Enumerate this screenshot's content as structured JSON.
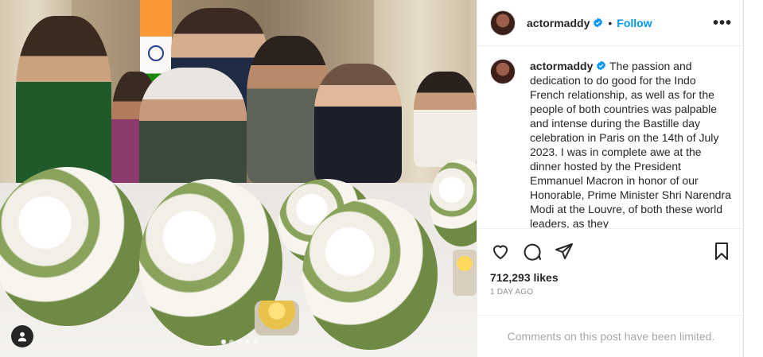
{
  "post": {
    "username": "actormaddy",
    "verified_badge": "verified-icon",
    "separator": "•",
    "follow_label": "Follow",
    "more_label": "•••",
    "caption": "The passion and dedication to do good for the Indo French relationship, as well as for the people of both countries was palpable and intense during the Bastille day celebration in Paris on the 14th of July 2023. I was in complete awe at the dinner hosted by the President Emmanuel Macron in honor of our Honorable, Prime Minister Shri Narendra Modi at the Louvre, of both these world leaders, as they",
    "likes": "712,293 likes",
    "time_ago": "1 DAY AGO",
    "comments_notice": "Comments on this post have been limited."
  },
  "media": {
    "carousel_total": 5,
    "carousel_active": 0,
    "tag_icon": "user-tag-icon"
  },
  "actions": {
    "like_icon": "heart-icon",
    "comment_icon": "comment-icon",
    "share_icon": "share-icon",
    "save_icon": "bookmark-icon"
  },
  "colors": {
    "accent": "#0095f6",
    "muted": "#8e8e8e"
  }
}
